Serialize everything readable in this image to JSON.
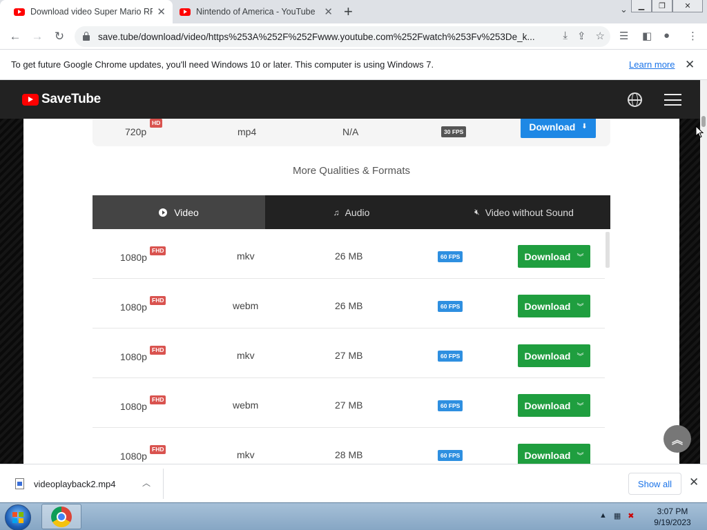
{
  "browser": {
    "tabs": [
      {
        "title": "Download video Super Mario RPG",
        "close": "✕"
      },
      {
        "title": "Nintendo of America - YouTube",
        "close": "✕"
      }
    ],
    "new_tab": "+",
    "url": "save.tube/download/video/https%253A%252F%252Fwww.youtube.com%252Fwatch%253Fv%253De_k..."
  },
  "infobar": {
    "message": "To get future Google Chrome updates, you'll need Windows 10 or later. This computer is using Windows 7.",
    "link": "Learn more",
    "close": "✕"
  },
  "site": {
    "logo": "SaveTube",
    "top_row": {
      "quality": "720p",
      "badge": "HD",
      "format": "mp4",
      "size": "N/A",
      "fps": "30 FPS",
      "button": "Download",
      "button_icon": "down-arrow-icon"
    },
    "more_title": "More Qualities & Formats",
    "tabs": [
      {
        "label": "Video",
        "icon": "play-circle-icon",
        "active": true
      },
      {
        "label": "Audio",
        "icon": "music-note-icon",
        "active": false
      },
      {
        "label": "Video without Sound",
        "icon": "mute-speaker-icon",
        "active": false
      }
    ],
    "rows": [
      {
        "quality": "1080p",
        "badge": "FHD",
        "format": "mkv",
        "size": "26 MB",
        "fps": "60 FPS",
        "button": "Download"
      },
      {
        "quality": "1080p",
        "badge": "FHD",
        "format": "webm",
        "size": "26 MB",
        "fps": "60 FPS",
        "button": "Download"
      },
      {
        "quality": "1080p",
        "badge": "FHD",
        "format": "mkv",
        "size": "27 MB",
        "fps": "60 FPS",
        "button": "Download"
      },
      {
        "quality": "1080p",
        "badge": "FHD",
        "format": "webm",
        "size": "27 MB",
        "fps": "60 FPS",
        "button": "Download"
      },
      {
        "quality": "1080p",
        "badge": "FHD",
        "format": "mkv",
        "size": "28 MB",
        "fps": "60 FPS",
        "button": "Download"
      }
    ]
  },
  "download_shelf": {
    "file": "videoplayback2.mp4",
    "show_all": "Show all"
  },
  "taskbar": {
    "time": "3:07 PM",
    "date": "9/19/2023"
  },
  "colors": {
    "download_blue": "#1e88e5",
    "download_green": "#1f9e3f",
    "badge_red": "#d9534f",
    "fps_blue": "#2e8fe0",
    "header_dark": "#222222"
  }
}
